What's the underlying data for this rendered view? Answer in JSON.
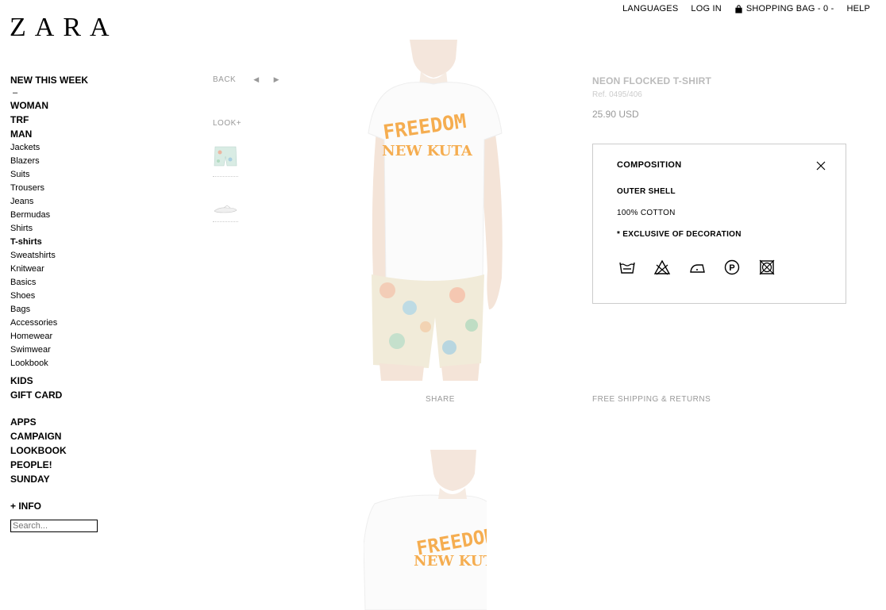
{
  "brand": "ZARA",
  "top_nav": {
    "languages": "LANGUAGES",
    "login": "LOG IN",
    "bag": "SHOPPING BAG - 0 -",
    "help": "HELP"
  },
  "sidebar": {
    "new_this_week": "NEW THIS WEEK",
    "dash": "–",
    "woman": "WOMAN",
    "trf": "TRF",
    "man": "MAN",
    "man_items": [
      "Jackets",
      "Blazers",
      "Suits",
      "Trousers",
      "Jeans",
      "Bermudas",
      "Shirts",
      "T-shirts",
      "Sweatshirts",
      "Knitwear",
      "Basics",
      "Shoes",
      "Bags",
      "Accessories",
      "Homewear",
      "Swimwear",
      "Lookbook"
    ],
    "kids": "KIDS",
    "gift_card": "GIFT CARD",
    "apps": "APPS",
    "campaign": "CAMPAIGN",
    "lookbook": "LOOKBOOK",
    "people": "PEOPLE!",
    "sunday": "SUNDAY",
    "info": "+ INFO",
    "search_placeholder": "Search..."
  },
  "controls": {
    "back": "BACK",
    "prev_arrow": "◀",
    "next_arrow": "▶",
    "look_plus": "LOOK+"
  },
  "product": {
    "name": "NEON FLOCKED T-SHIRT",
    "ref": "Ref. 0495/406",
    "price": "25.90 USD",
    "shirt_text_1": "FREEDOM",
    "shirt_text_2": "NEW KUTA"
  },
  "composition": {
    "title": "COMPOSITION",
    "outer_shell": "OUTER SHELL",
    "cotton": "100% COTTON",
    "exclusive": "* EXCLUSIVE OF DECORATION",
    "care_icons": [
      "wash-30-icon",
      "no-bleach-icon",
      "iron-low-icon",
      "dry-clean-p-icon",
      "no-tumble-dry-icon"
    ]
  },
  "share": "SHARE",
  "shipping": "FREE SHIPPING & RETURNS",
  "colors": {
    "accent_text": "#f5a033",
    "muted": "#999999"
  }
}
